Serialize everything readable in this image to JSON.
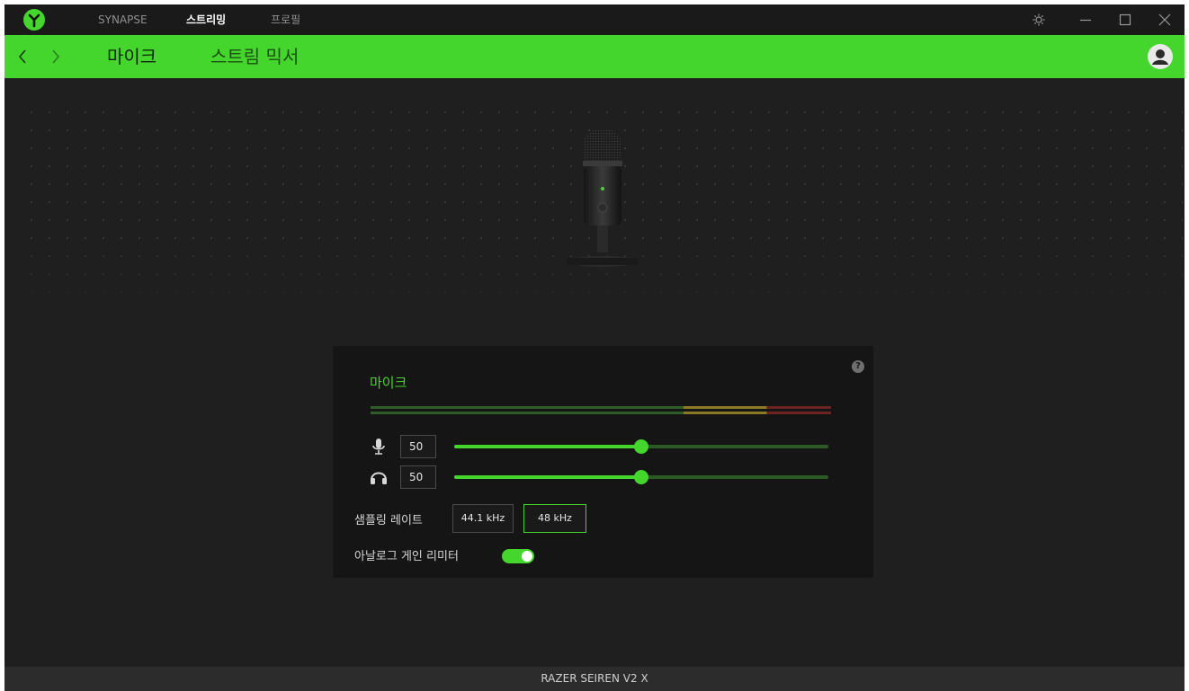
{
  "window": {
    "top_nav": [
      {
        "label": "SYNAPSE",
        "active": false
      },
      {
        "label": "스트리밍",
        "active": true
      },
      {
        "label": "프로필",
        "active": false
      }
    ]
  },
  "header": {
    "tabs": [
      {
        "label": "마이크",
        "active": true
      },
      {
        "label": "스트림 믹서",
        "active": false
      }
    ]
  },
  "panel": {
    "title": "마이크",
    "mic_gain": {
      "value": "50",
      "level_percent": 50
    },
    "headphone_volume": {
      "value": "50",
      "level_percent": 50
    },
    "sampling_rate": {
      "label": "샘플링 레이트",
      "options": [
        "44.1 kHz",
        "48 kHz"
      ],
      "selected": "48 kHz"
    },
    "analog_gain_limiter": {
      "label": "아날로그 게인 리미터",
      "enabled": true
    },
    "help": "?"
  },
  "footer": {
    "device_name": "RAZER SEIREN V2 X"
  },
  "colors": {
    "accent": "#44d62c",
    "meter_green": "#2e5d28",
    "meter_yellow": "#8a7a26",
    "meter_red": "#6e2323"
  },
  "icons": [
    "razer-logo-icon",
    "brightness-icon",
    "minimize-icon",
    "maximize-icon",
    "close-icon",
    "back-arrow-icon",
    "forward-arrow-icon",
    "user-avatar-icon",
    "microphone-icon",
    "headphones-icon",
    "help-icon"
  ]
}
